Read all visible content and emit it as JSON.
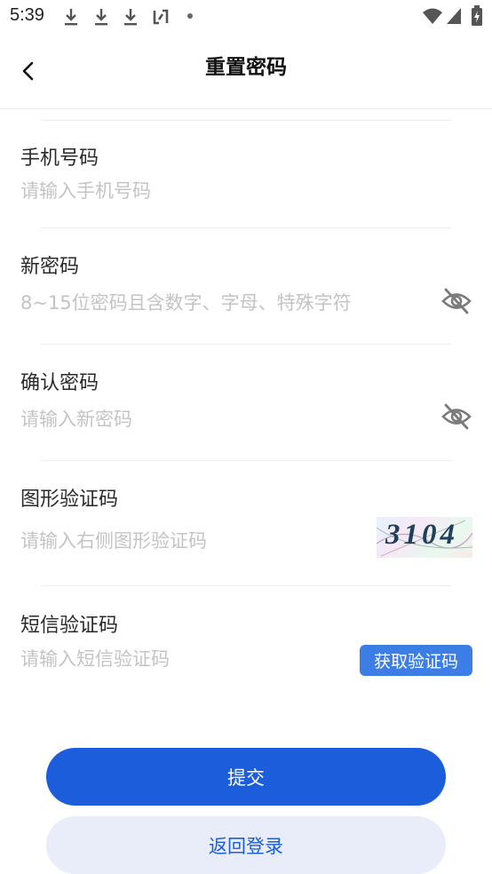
{
  "status_bar": {
    "time": "5:39",
    "icons": [
      "download-icon",
      "download-icon",
      "download-icon",
      "sync-icon",
      "dot-icon",
      "wifi-icon",
      "signal-icon",
      "battery-charging-icon"
    ]
  },
  "header": {
    "title": "重置密码",
    "back_icon": "chevron-left-icon"
  },
  "fields": {
    "phone": {
      "label": "手机号码",
      "placeholder": "请输入手机号码"
    },
    "new_password": {
      "label": "新密码",
      "placeholder": "8~15位密码且含数字、字母、特殊字符",
      "toggle_icon": "eye-off-icon"
    },
    "confirm_password": {
      "label": "确认密码",
      "placeholder": "请输入新密码",
      "toggle_icon": "eye-off-icon"
    },
    "captcha": {
      "label": "图形验证码",
      "placeholder": "请输入右侧图形验证码",
      "image_text": "3104"
    },
    "sms": {
      "label": "短信验证码",
      "placeholder": "请输入短信验证码",
      "button_label": "获取验证码"
    }
  },
  "actions": {
    "submit_label": "提交",
    "back_login_label": "返回登录"
  },
  "colors": {
    "primary": "#1c5ddc",
    "sms_button": "#3d7ee6",
    "secondary_button_bg": "#e8edf9",
    "placeholder": "#c4c4c4"
  }
}
